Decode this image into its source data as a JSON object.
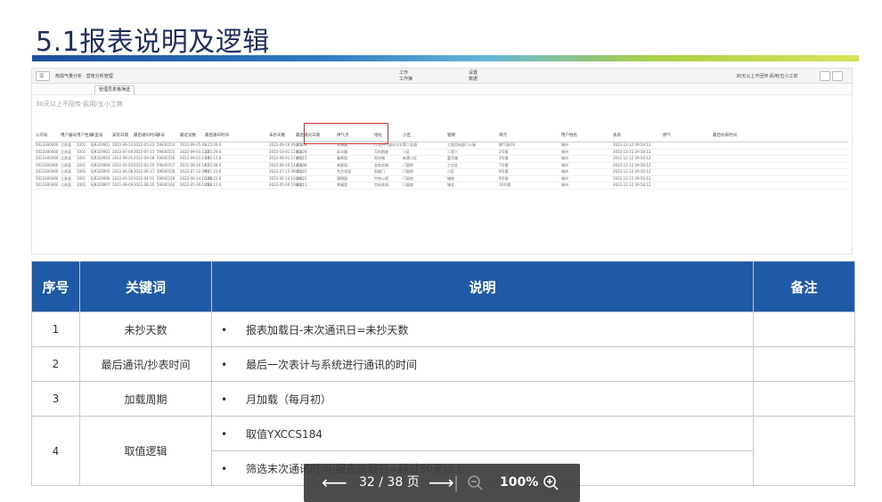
{
  "slide": {
    "title": "5.1报表说明及逻辑"
  },
  "embedded": {
    "toolbar": {
      "menu_icon": "menu-icon",
      "breadcrumb": "热损气量分析 · 营收分析管理",
      "center_label_top": "工作",
      "center_label_value": "工作簿",
      "share_label_top": "设置",
      "share_label": "数据",
      "right_text": "30天以上不回传·民用/五小工商"
    },
    "tab_label": "管理员表格筛选",
    "report_subtitle": "30天以上不回传-民用/五小工商",
    "columns": [
      "公司号",
      "用户编号",
      "用户性质",
      "表型号",
      "安装日期",
      "最后通讯时间",
      "表号",
      "最近读数",
      "最后通讯时间",
      "未抄天数",
      "最后通讯日期",
      "供气点",
      "地址",
      "小区",
      "管网",
      "单元",
      "用户姓名",
      "表具",
      "燃气",
      "最后抄表时间"
    ],
    "rows_sample": [
      [
        "5023300400",
        "江苏县",
        "1001",
        "EJ9320901",
        "2022-06-13",
        "2022-05-03",
        "59830154",
        "2022-09-25 09:25:09.0",
        "1",
        "2022-09-26 09:25:08",
        "苏北",
        "金湖路",
        "江北供气部分大学",
        "第二金道",
        "工程用电部门小屋",
        "燃气表4号",
        "城市",
        "2022-12-12 09:50:12"
      ],
      [
        "5023300400",
        "江苏县",
        "1001",
        "EJ9320902",
        "2022-07-04",
        "2022-07-15",
        "59830155",
        "2022-09-01 12:02:29.0",
        "12",
        "2022-10-01 12:02:29",
        "苏北",
        "彩丰路",
        "万科首座",
        "小区",
        "二室六",
        "2号楼",
        "城市",
        "2022-12-12 09:50:12"
      ],
      [
        "5023300400",
        "江苏县",
        "1001",
        "EJ9320903",
        "2022-09-05",
        "2022-09-08",
        "59830156",
        "2022-09-01 17:05:15.0",
        "23",
        "2022-09-01 17:05:15",
        "苏北",
        "春晖园",
        "阳光城",
        "新建小区",
        "富华路",
        "3号楼",
        "城市",
        "2022-12-12 09:50:12"
      ],
      [
        "5023300400",
        "江苏县",
        "1001",
        "EJ9320904",
        "2022-02-03",
        "2022-02-20",
        "59830157",
        "2022-08-10 14:22:08.0",
        "67",
        "2022-08-10 14:22:08",
        "苏北",
        "海棠园",
        "金地名城",
        "门面房",
        "工业区",
        "7号楼",
        "城市",
        "2022-12-12 09:50:12"
      ],
      [
        "5023300400",
        "江苏县",
        "1001",
        "EJ9320905",
        "2022-06-08",
        "2022-06-17",
        "59830158",
        "2022-07-12 08:11:41.0",
        "90",
        "2022-07-12 08:11:41",
        "苏北",
        "东方花园",
        "凯旋门",
        "门面房",
        "小区",
        "8号楼",
        "城市",
        "2022-12-12 09:50:12"
      ],
      [
        "5023300400",
        "江苏县",
        "1001",
        "EJ9320906",
        "2022-03-20",
        "2022-04-01",
        "59830159",
        "2022-06-14 10:30:22.0",
        "120",
        "2022-06-14 10:30:22",
        "苏北",
        "锦绣园",
        "中央公馆",
        "门面房",
        "城南",
        "9号楼",
        "城市",
        "2022-12-12 09:50:12"
      ],
      [
        "5023300400",
        "江苏县",
        "1001",
        "EJ9320907",
        "2021-08-09",
        "2021-08-20",
        "59830160",
        "2022-05-09 19:02:11.0",
        "153",
        "2022-05-09 19:02:11",
        "苏北",
        "幸福里",
        "世纪花园",
        "门面房",
        "城北",
        "10号楼",
        "城市",
        "2022-12-12 09:50:12"
      ]
    ],
    "highlight_column": "未抄天数"
  },
  "table": {
    "headers": [
      "序号",
      "关键词",
      "说明",
      "备注"
    ],
    "rows": [
      {
        "no": "1",
        "keyword": "未抄天数",
        "bullets": [
          "报表加载日-末次通讯日=未抄天数"
        ],
        "note": ""
      },
      {
        "no": "2",
        "keyword": "最后通讯/抄表时间",
        "bullets": [
          "最后一次表计与系统进行通讯的时间"
        ],
        "note": ""
      },
      {
        "no": "3",
        "keyword": "加载周期",
        "bullets": [
          "月加载（每月初）"
        ],
        "note": ""
      },
      {
        "no": "4",
        "keyword": "取值逻辑",
        "bullets": [
          "取值YXCCS184",
          "筛选末次通讯时间-报表加载日=超过30天以上"
        ],
        "note": ""
      }
    ],
    "bullet_char": "•"
  },
  "pager": {
    "prev_icon": "arrow-left-icon",
    "page_text": "32 / 38 页",
    "next_icon": "arrow-right-icon",
    "zoom_out_icon": "zoom-out-icon",
    "zoom_text": "100%",
    "zoom_in_icon": "zoom-in-icon"
  }
}
